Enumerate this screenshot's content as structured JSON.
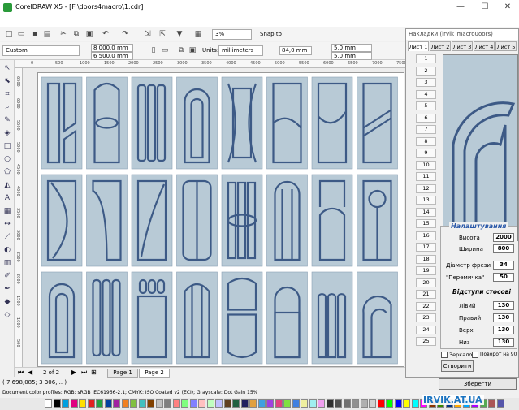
{
  "window": {
    "title": "CorelDRAW X5 - [F:\\doors4macro\\1.cdr]"
  },
  "toolbar": {
    "zoom": "3%",
    "snap_to": "Snap to"
  },
  "propertybar": {
    "preset": "Custom",
    "width": "8 000,0 mm",
    "height": "6 500,0 mm",
    "units_label": "Units:",
    "units": "millimeters",
    "nudge": "84,0 mm",
    "dup_x": "5,0 mm",
    "dup_y": "5,0 mm"
  },
  "ruler": {
    "top": [
      "0",
      "500",
      "1000",
      "1500",
      "2000",
      "2500",
      "3000",
      "3500",
      "4000",
      "4500",
      "5000",
      "5500",
      "6000",
      "6500",
      "7000",
      "7500"
    ],
    "left": [
      "6500",
      "6000",
      "5500",
      "5000",
      "4500",
      "4000",
      "3500",
      "3000",
      "2500",
      "2000",
      "1500",
      "1000",
      "500"
    ],
    "unit": "millimeters"
  },
  "pagebar": {
    "pos": "2 of 2",
    "pages": [
      "Page 1",
      "Page 2"
    ],
    "active": 1
  },
  "status": {
    "coords": "( 7 698,085; 3 306,... )",
    "profiles": "Document color profiles: RGB: sRGB IEC61966-2.1; CMYK: ISO Coated v2 (ECI); Grayscale: Dot Gain 15%"
  },
  "panel": {
    "title": "Накладки (irvik_macro0oors)",
    "tabs": [
      "Лист 1",
      "Лист 2",
      "Лист 3",
      "Лист 4",
      "Лист 5"
    ],
    "active_tab": 0,
    "numbers": [
      "1",
      "2",
      "3",
      "4",
      "5",
      "6",
      "7",
      "8",
      "9",
      "10",
      "11",
      "12",
      "13",
      "14",
      "15",
      "16",
      "17",
      "18",
      "19",
      "20",
      "21",
      "22",
      "23",
      "24",
      "25"
    ],
    "settings_title": "Налаштування",
    "height_label": "Висота",
    "height": "2000",
    "width_label": "Ширина",
    "width": "800",
    "cutter_label": "Діаметр фрези",
    "cutter": "34",
    "bridge_label": "\"Перемичка\"",
    "bridge": "50",
    "offsets_title": "Відступи стосові",
    "left_label": "Лівий",
    "left": "130",
    "right_label": "Правий",
    "right": "130",
    "top_label": "Верх",
    "top": "130",
    "bottom_label": "Низ",
    "bottom": "130",
    "mirror_label": "Зеркало",
    "rotate_label": "Поворот на 90",
    "create_label": "Створити",
    "save_label": "Зберегти"
  },
  "watermark": "IRVIK.AT.UA",
  "colors": {
    "door_fill": "#b8cad6",
    "door_line": "#3d5a86",
    "accent": "#2a58a8"
  },
  "palette": [
    "#ffffff",
    "#000000",
    "#00a0e0",
    "#e00080",
    "#ffe000",
    "#e02020",
    "#20a040",
    "#0040a0",
    "#a020a0",
    "#f08020",
    "#80c040",
    "#40c0c0",
    "#804000",
    "#c0c0c0",
    "#808080",
    "#ff8080",
    "#80ff80",
    "#8080ff",
    "#ffc0c0",
    "#c0ffc0",
    "#c0c0ff",
    "#604020",
    "#206040",
    "#202060",
    "#e0a040",
    "#40a0e0",
    "#a040e0",
    "#e04080",
    "#80e040",
    "#4080e0",
    "#f0f0a0",
    "#a0f0f0",
    "#f0a0f0",
    "#303030",
    "#505050",
    "#707070",
    "#909090",
    "#b0b0b0",
    "#d0d0d0",
    "#ff0000",
    "#00ff00",
    "#0000ff",
    "#ffff00",
    "#00ffff",
    "#ff00ff",
    "#883300",
    "#338800",
    "#003388",
    "#ffaa00",
    "#00aaff",
    "#aa00ff",
    "#55aa55",
    "#aa5555",
    "#5555aa"
  ]
}
